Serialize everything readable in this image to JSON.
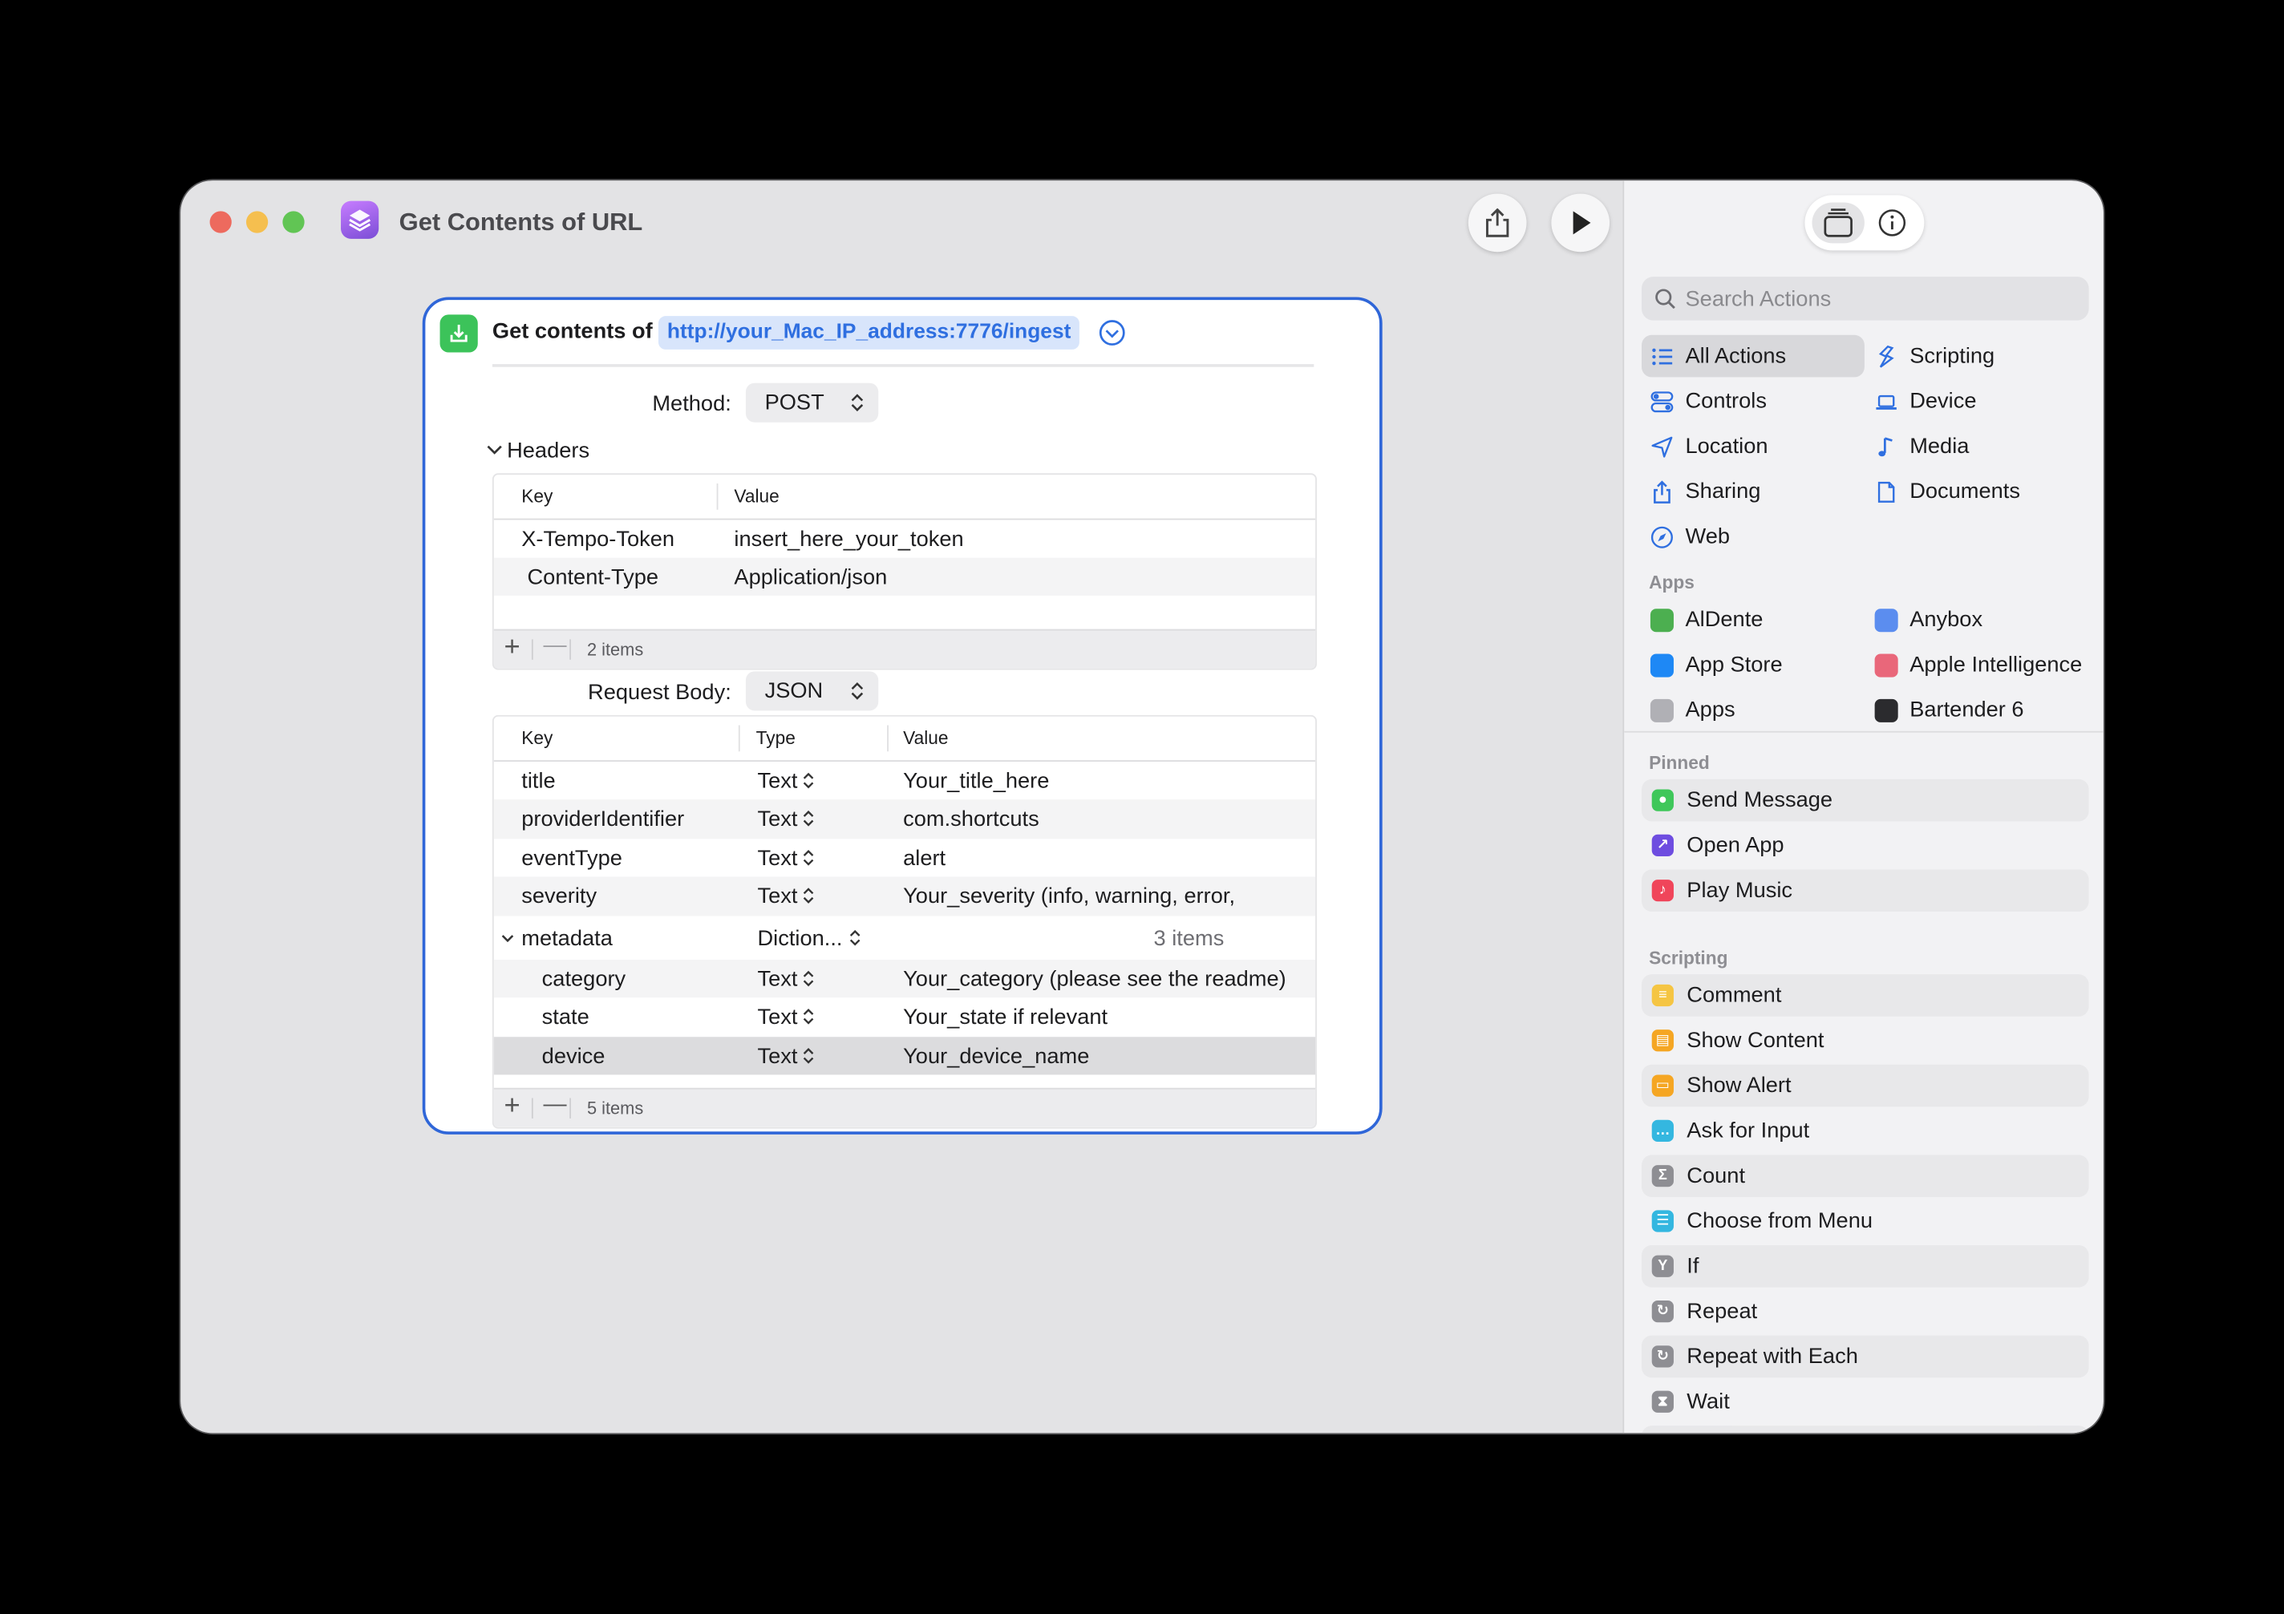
{
  "window": {
    "title": "Get Contents of URL",
    "colors": {
      "close": "#ed6a5e",
      "minimize": "#f5bf4f",
      "zoom": "#61c554"
    }
  },
  "toolbar": {
    "share_icon": "share-icon",
    "run_icon": "play-icon"
  },
  "action": {
    "prefix": "Get contents of",
    "url": "http://your_Mac_IP_address:7776/ingest",
    "method_label": "Method:",
    "method_value": "POST",
    "headers_label": "Headers",
    "headers": {
      "columns": [
        "Key",
        "Value"
      ],
      "rows": [
        {
          "key": "X-Tempo-Token",
          "value": "insert_here_your_token"
        },
        {
          "key": "Content-Type",
          "value": "Application/json"
        }
      ],
      "count": "2 items"
    },
    "body_label": "Request Body:",
    "body_value": "JSON",
    "body": {
      "columns": [
        "Key",
        "Type",
        "Value"
      ],
      "rows": [
        {
          "key": "title",
          "type": "Text",
          "value": "Your_title_here"
        },
        {
          "key": "providerIdentifier",
          "type": "Text",
          "value": "com.shortcuts"
        },
        {
          "key": "eventType",
          "type": "Text",
          "value": "alert"
        },
        {
          "key": "severity",
          "type": "Text",
          "value": "Your_severity (info, warning, error,"
        },
        {
          "key": "metadata",
          "type": "Diction...",
          "value": "3 items"
        },
        {
          "key": "category",
          "type": "Text",
          "value": "Your_category (please see the readme)"
        },
        {
          "key": "state",
          "type": "Text",
          "value": "Your_state if relevant"
        },
        {
          "key": "device",
          "type": "Text",
          "value": "Your_device_name"
        }
      ],
      "count": "5 items"
    }
  },
  "sidebar": {
    "search_placeholder": "Search Actions",
    "categories": [
      {
        "label": "All Actions",
        "icon": "list-icon",
        "selected": true
      },
      {
        "label": "Scripting",
        "icon": "scripting-icon"
      },
      {
        "label": "Controls",
        "icon": "toggles-icon"
      },
      {
        "label": "Device",
        "icon": "laptop-icon"
      },
      {
        "label": "Location",
        "icon": "location-arrow-icon"
      },
      {
        "label": "Media",
        "icon": "music-note-icon"
      },
      {
        "label": "Sharing",
        "icon": "share-icon"
      },
      {
        "label": "Documents",
        "icon": "document-icon"
      },
      {
        "label": "Web",
        "icon": "compass-icon"
      }
    ],
    "apps_header": "Apps",
    "apps": [
      {
        "label": "AlDente",
        "color": "#4caf50"
      },
      {
        "label": "Anybox",
        "color": "#5b8def"
      },
      {
        "label": "App Store",
        "color": "#1e88f5"
      },
      {
        "label": "Apple Intelligence",
        "color": "#e9677a"
      },
      {
        "label": "Apps",
        "color": "#b0b0b5"
      },
      {
        "label": "Bartender 6",
        "color": "#2b2b2e"
      }
    ],
    "pinned_header": "Pinned",
    "pinned": [
      {
        "label": "Send Message",
        "color": "#3fc75a",
        "glyph": "message-icon"
      },
      {
        "label": "Open App",
        "color": "#6e4de0",
        "glyph": "open-app-icon"
      },
      {
        "label": "Play Music",
        "color": "#f0455a",
        "glyph": "music-note-icon"
      }
    ],
    "scripting_header": "Scripting",
    "scripting": [
      {
        "label": "Comment",
        "color": "#f5c543",
        "glyph": "lines-icon"
      },
      {
        "label": "Show Content",
        "color": "#f5a623",
        "glyph": "content-icon"
      },
      {
        "label": "Show Alert",
        "color": "#f5a623",
        "glyph": "alert-icon"
      },
      {
        "label": "Ask for Input",
        "color": "#34b7e0",
        "glyph": "speech-icon"
      },
      {
        "label": "Count",
        "color": "#8e8e93",
        "glyph": "sigma-icon"
      },
      {
        "label": "Choose from Menu",
        "color": "#34b7e0",
        "glyph": "menu-icon"
      },
      {
        "label": "If",
        "color": "#8e8e93",
        "glyph": "branch-icon"
      },
      {
        "label": "Repeat",
        "color": "#8e8e93",
        "glyph": "repeat-icon"
      },
      {
        "label": "Repeat with Each",
        "color": "#8e8e93",
        "glyph": "repeat-icon"
      },
      {
        "label": "Wait",
        "color": "#8e8e93",
        "glyph": "hourglass-icon"
      }
    ]
  }
}
